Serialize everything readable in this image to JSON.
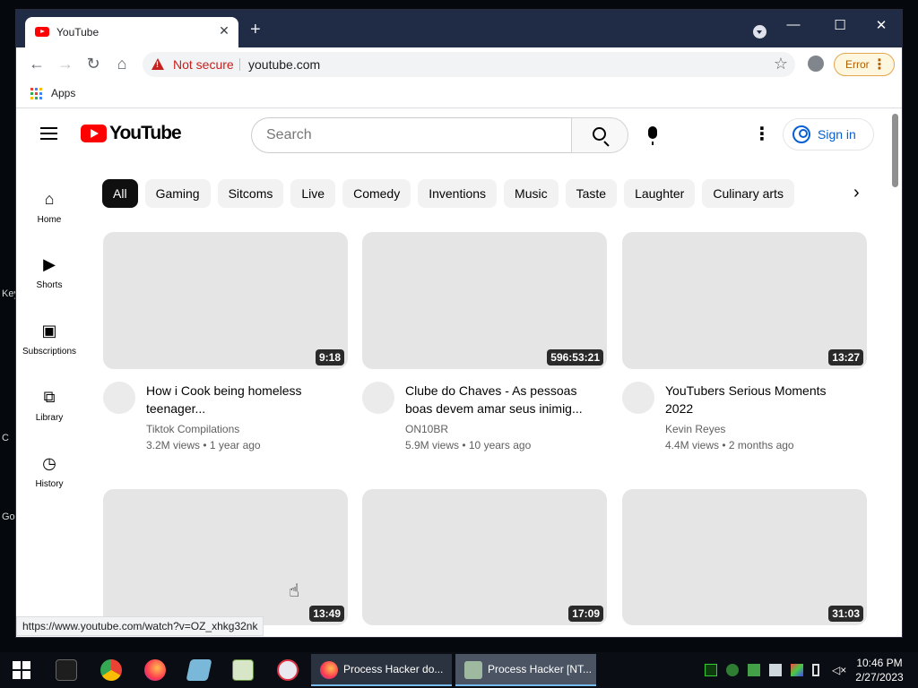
{
  "desktop": {
    "fragments": [
      "Key",
      "C",
      "Go"
    ]
  },
  "browser": {
    "tab_title": "YouTube",
    "tab_close": "✕",
    "new_tab": "+",
    "window_controls": [
      "—",
      "☐",
      "✕"
    ],
    "security_label": "Not secure",
    "url": "youtube.com",
    "error_label": "Error",
    "bookmarks": {
      "apps_label": "Apps"
    },
    "status_url": "https://www.youtube.com/watch?v=OZ_xhkg32nk"
  },
  "youtube": {
    "logo_text": "YouTube",
    "search_placeholder": "Search",
    "sign_in": "Sign in",
    "guide": [
      {
        "label": "Home",
        "icon": "home-icon"
      },
      {
        "label": "Shorts",
        "icon": "shorts-icon"
      },
      {
        "label": "Subscriptions",
        "icon": "subscriptions-icon"
      },
      {
        "label": "Library",
        "icon": "library-icon"
      },
      {
        "label": "History",
        "icon": "history-icon"
      }
    ],
    "chips": [
      "All",
      "Gaming",
      "Sitcoms",
      "Live",
      "Comedy",
      "Inventions",
      "Music",
      "Taste",
      "Laughter",
      "Culinary arts"
    ],
    "videos": [
      {
        "duration": "9:18",
        "title": "How i Cook being homeless teenager...",
        "channel": "Tiktok Compilations",
        "meta": "3.2M views • 1 year ago"
      },
      {
        "duration": "596:53:21",
        "title": "Clube do Chaves - As pessoas boas devem amar seus inimig...",
        "channel": "ON10BR",
        "meta": "5.9M views • 10 years ago"
      },
      {
        "duration": "13:27",
        "title": "YouTubers Serious Moments 2022",
        "channel": "Kevin Reyes",
        "meta": "4.4M views • 2 months ago"
      },
      {
        "duration": "13:49"
      },
      {
        "duration": "17:09"
      },
      {
        "duration": "31:03"
      }
    ]
  },
  "taskbar": {
    "windows": [
      {
        "label": "Process Hacker do...",
        "icon": "firefox-icon"
      },
      {
        "label": "Process Hacker [NT...",
        "icon": "process-hacker-icon"
      }
    ],
    "time": "10:46 PM",
    "date": "2/27/2023"
  },
  "colors": {
    "yt_red": "#ff0000",
    "link_blue": "#065fd4",
    "tabstrip": "#202b46",
    "warning_red": "#c5221f"
  }
}
